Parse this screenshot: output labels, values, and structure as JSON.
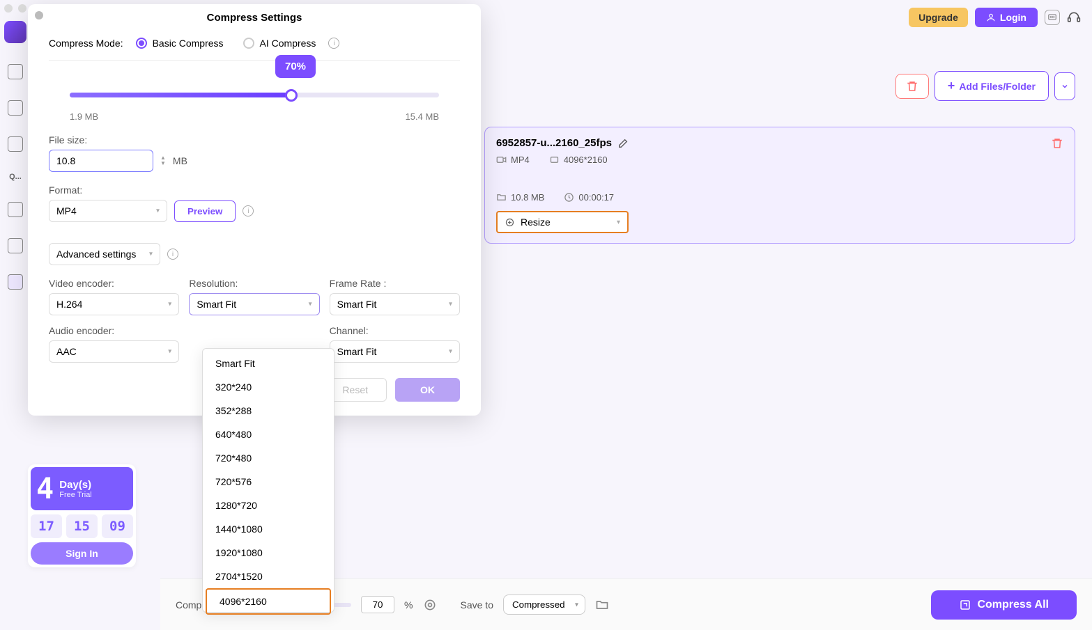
{
  "header": {
    "upgrade": "Upgrade",
    "login": "Login"
  },
  "sidebar": {
    "q_label": "Q..."
  },
  "promo": {
    "big_num": "4",
    "days_label": "Day(s)",
    "trial_label": "Free Trial",
    "t1": "17",
    "t2": "15",
    "t3": "09",
    "signin": "Sign In"
  },
  "toolbar": {
    "add_files": "Add Files/Folder"
  },
  "file_card": {
    "title": "6952857-u...2160_25fps",
    "format": "MP4",
    "resolution": "4096*2160",
    "size": "10.8 MB",
    "duration": "00:00:17",
    "resize_label": "Resize"
  },
  "bottom": {
    "compress_all_to": "Compress All to",
    "percent_value": "70",
    "percent_label": "%",
    "save_to": "Save to",
    "save_value": "Compressed",
    "compress_all": "Compress All"
  },
  "dialog": {
    "title": "Compress Settings",
    "mode_label": "Compress Mode:",
    "mode_basic": "Basic Compress",
    "mode_ai": "AI Compress",
    "slider_value": "70%",
    "slider_min": "1.9 MB",
    "slider_max": "15.4 MB",
    "filesize_label": "File size:",
    "filesize_value": "10.8",
    "filesize_unit": "MB",
    "format_label": "Format:",
    "format_value": "MP4",
    "preview": "Preview",
    "advanced": "Advanced settings",
    "video_encoder_label": "Video encoder:",
    "video_encoder_value": "H.264",
    "resolution_label": "Resolution:",
    "resolution_value": "Smart Fit",
    "framerate_label": "Frame Rate :",
    "framerate_value": "Smart Fit",
    "audio_encoder_label": "Audio encoder:",
    "audio_encoder_value": "AAC",
    "channel_label": "Channel:",
    "channel_value": "Smart Fit",
    "reset": "Reset",
    "ok": "OK",
    "res_options": [
      "Smart Fit",
      "320*240",
      "352*288",
      "640*480",
      "720*480",
      "720*576",
      "1280*720",
      "1440*1080",
      "1920*1080",
      "2704*1520",
      "4096*2160"
    ]
  }
}
